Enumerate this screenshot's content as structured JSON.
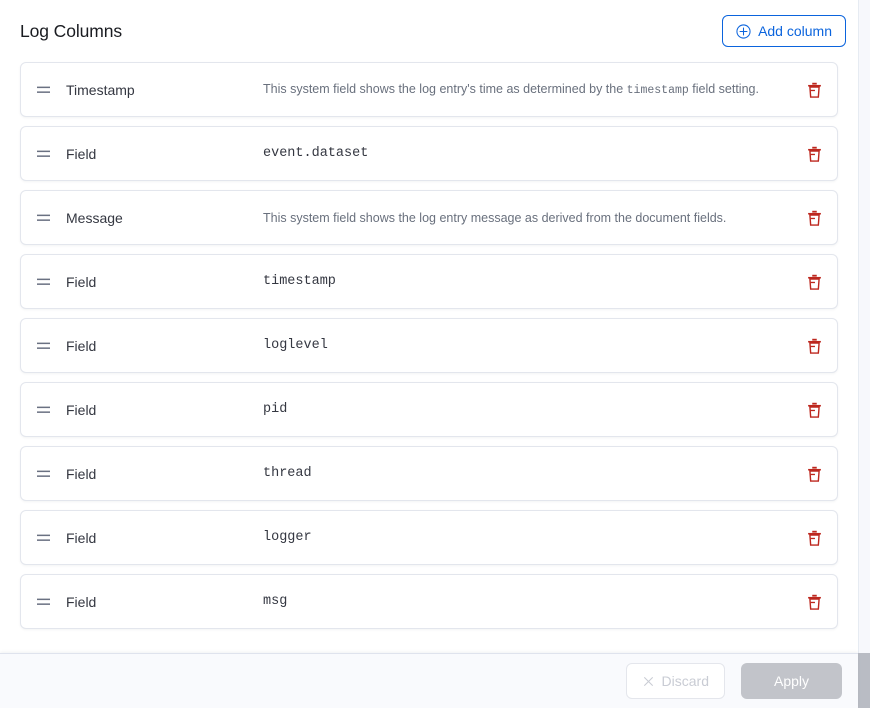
{
  "header": {
    "title": "Log Columns",
    "add_column_label": "Add column",
    "add_icon": "plus-in-circle-icon",
    "accent_color": "#0b64dd"
  },
  "rows": [
    {
      "type": "system",
      "label": "Timestamp",
      "description_before": "This system field shows the log entry's time as determined by the ",
      "description_code": "timestamp",
      "description_after": " field setting.",
      "drag_icon": "drag-handle-icon",
      "delete_icon": "trash-icon"
    },
    {
      "type": "field",
      "label": "Field",
      "value": "event.dataset",
      "drag_icon": "drag-handle-icon",
      "delete_icon": "trash-icon"
    },
    {
      "type": "system",
      "label": "Message",
      "description_before": "This system field shows the log entry message as derived from the document fields.",
      "description_code": "",
      "description_after": "",
      "drag_icon": "drag-handle-icon",
      "delete_icon": "trash-icon"
    },
    {
      "type": "field",
      "label": "Field",
      "value": "timestamp",
      "drag_icon": "drag-handle-icon",
      "delete_icon": "trash-icon"
    },
    {
      "type": "field",
      "label": "Field",
      "value": "loglevel",
      "drag_icon": "drag-handle-icon",
      "delete_icon": "trash-icon"
    },
    {
      "type": "field",
      "label": "Field",
      "value": "pid",
      "drag_icon": "drag-handle-icon",
      "delete_icon": "trash-icon"
    },
    {
      "type": "field",
      "label": "Field",
      "value": "thread",
      "drag_icon": "drag-handle-icon",
      "delete_icon": "trash-icon"
    },
    {
      "type": "field",
      "label": "Field",
      "value": "logger",
      "drag_icon": "drag-handle-icon",
      "delete_icon": "trash-icon"
    },
    {
      "type": "field",
      "label": "Field",
      "value": "msg",
      "drag_icon": "drag-handle-icon",
      "delete_icon": "trash-icon"
    }
  ],
  "footer": {
    "discard_label": "Discard",
    "discard_icon": "cross-icon",
    "discard_disabled": true,
    "apply_label": "Apply",
    "apply_disabled": true,
    "disabled_color": "#c2c4ca"
  },
  "colors": {
    "danger": "#bd271e",
    "row_border": "#e3e6ed",
    "text_primary": "#343741",
    "text_muted": "#69707d",
    "footer_bg": "#f9fafd"
  }
}
